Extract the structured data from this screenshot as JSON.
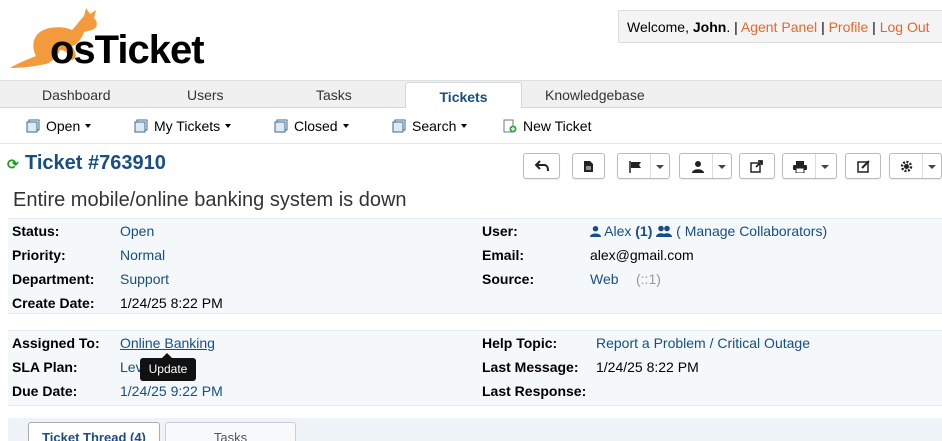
{
  "header": {
    "logo_text": "osTicket",
    "welcome_prefix": "Welcome, ",
    "user_name": "John",
    "welcome_suffix": ".",
    "links": [
      "Agent Panel",
      "Profile",
      "Log Out"
    ]
  },
  "nav": {
    "tabs": [
      "Dashboard",
      "Users",
      "Tasks",
      "Tickets",
      "Knowledgebase"
    ],
    "active": "Tickets"
  },
  "subnav": {
    "items": [
      "Open",
      "My Tickets",
      "Closed",
      "Search",
      "New Ticket"
    ]
  },
  "ticket": {
    "title": "Ticket #763910",
    "subject": "Entire mobile/online banking system is down",
    "toolbar_icons": [
      "reply-icon",
      "print-pdf-icon",
      "flag-icon",
      "user-icon",
      "share-icon",
      "print-icon",
      "edit-icon",
      "gear-icon"
    ]
  },
  "info1": {
    "status_label": "Status:",
    "status": "Open",
    "priority_label": "Priority:",
    "priority": "Normal",
    "department_label": "Department:",
    "department": "Support",
    "create_date_label": "Create Date:",
    "create_date": "1/24/25 8:22 PM",
    "user_label": "User:",
    "user": "Alex",
    "user_count": "(1)",
    "manage_collaborators": "( Manage Collaborators)",
    "email_label": "Email:",
    "email": "alex@gmail.com",
    "source_label": "Source:",
    "source": "Web",
    "source_extra": "(::1)"
  },
  "info2": {
    "assigned_label": "Assigned To:",
    "assigned": "Online Banking",
    "sla_label": "SLA Plan:",
    "sla": "Lev",
    "due_label": "Due Date:",
    "due": "1/24/25 9:22 PM",
    "help_topic_label": "Help Topic:",
    "help_topic": "Report a Problem / Critical Outage",
    "last_message_label": "Last Message:",
    "last_message": "1/24/25 8:22 PM",
    "last_response_label": "Last Response:",
    "last_response": ""
  },
  "tooltip": "Update",
  "bottom_tabs": [
    "Ticket Thread (4)",
    "Tasks"
  ],
  "colors": {
    "brand_orange": "#e26a2b",
    "link_blue": "#184e81",
    "refresh_green": "#1f9b1f"
  }
}
